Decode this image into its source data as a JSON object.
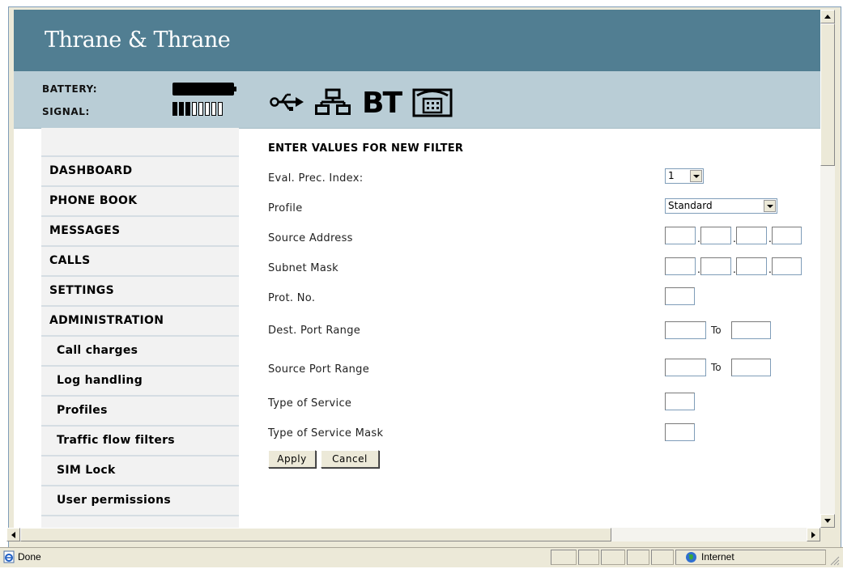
{
  "header": {
    "brand": "Thrane & Thrane",
    "battery_label": "BATTERY:",
    "signal_label": "SIGNAL:",
    "signal_level": 3,
    "signal_max": 8,
    "battery_level": 1.0,
    "interface_icons": [
      "usb-icon",
      "lan-icon",
      "bluetooth-icon",
      "phone-icon"
    ],
    "bt_text": "BT"
  },
  "sidebar": {
    "items": [
      {
        "label": "DASHBOARD"
      },
      {
        "label": "PHONE BOOK"
      },
      {
        "label": "MESSAGES"
      },
      {
        "label": "CALLS"
      },
      {
        "label": "SETTINGS"
      },
      {
        "label": "ADMINISTRATION"
      },
      {
        "label": "Call charges"
      },
      {
        "label": "Log handling"
      },
      {
        "label": "Profiles"
      },
      {
        "label": "Traffic flow filters"
      },
      {
        "label": "SIM Lock"
      },
      {
        "label": "User permissions"
      }
    ]
  },
  "form": {
    "title": "ENTER VALUES FOR NEW FILTER",
    "labels": {
      "eval": "Eval. Prec. Index:",
      "profile": "Profile",
      "source_address": "Source Address",
      "subnet_mask": "Subnet Mask",
      "prot_no": "Prot. No.",
      "dest_port": "Dest. Port Range",
      "source_port": "Source Port Range",
      "tos": "Type of Service",
      "tos_mask": "Type of Service Mask"
    },
    "eval_value": "1",
    "profile_value": "Standard",
    "to_label": "To",
    "apply_label": "Apply",
    "cancel_label": "Cancel"
  },
  "browser": {
    "status_text": "Done",
    "zone_text": "Internet"
  },
  "colors": {
    "banner": "#517e92",
    "status_band": "#b9cdd6",
    "sidebar": "#f2f2f2"
  }
}
